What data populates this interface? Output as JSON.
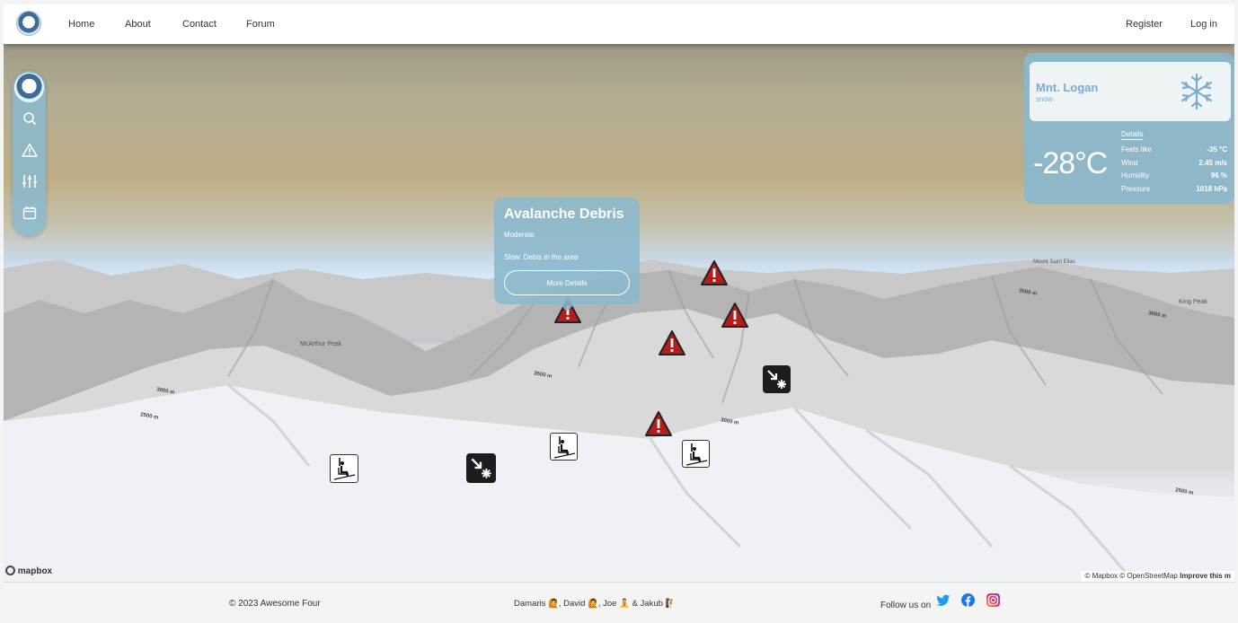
{
  "header": {
    "nav": [
      "Home",
      "About",
      "Contact",
      "Forum"
    ],
    "register": "Register",
    "login": "Log in"
  },
  "map": {
    "places": [
      "McArthur Peak",
      "Mount Saint Elias",
      "King Peak"
    ],
    "elevations": [
      "3000 m",
      "2500 m",
      "3500 m",
      "3000 m",
      "3000 m",
      "3500 m",
      "2500 m"
    ],
    "provider_logo": "mapbox",
    "attribution": "© Mapbox © OpenStreetMap",
    "improve": "Improve this m"
  },
  "popup": {
    "title": "Avalanche Debris",
    "level": "Moderate",
    "description": "Slow: Debis in the area",
    "button": "More Details"
  },
  "weather": {
    "location": "Mnt. Logan",
    "condition": "snow",
    "icon": "snowflake-icon",
    "temperature": "-28°C",
    "details_label": "Details",
    "rows": [
      {
        "label": "Feels like",
        "value": "-35 °C"
      },
      {
        "label": "Wind",
        "value": "2.45 m/s"
      },
      {
        "label": "Humidity",
        "value": "96 %"
      },
      {
        "label": "Pressure",
        "value": "1018 hPa"
      }
    ]
  },
  "toolbar": {
    "icons": [
      "search-icon",
      "warning-icon",
      "sliders-icon",
      "calendar-icon"
    ]
  },
  "footer": {
    "copyright": "© 2023 Awesome Four",
    "credits": "Damaris 🙋, David 🙋, Joe 🧘 & Jakub 🧗",
    "follow": "Follow us on"
  },
  "colors": {
    "accent": "#8ab8cd",
    "warning_red": "#b71c1c",
    "debris_black": "#1d1d1d",
    "snow_blue": "#79acd0"
  }
}
